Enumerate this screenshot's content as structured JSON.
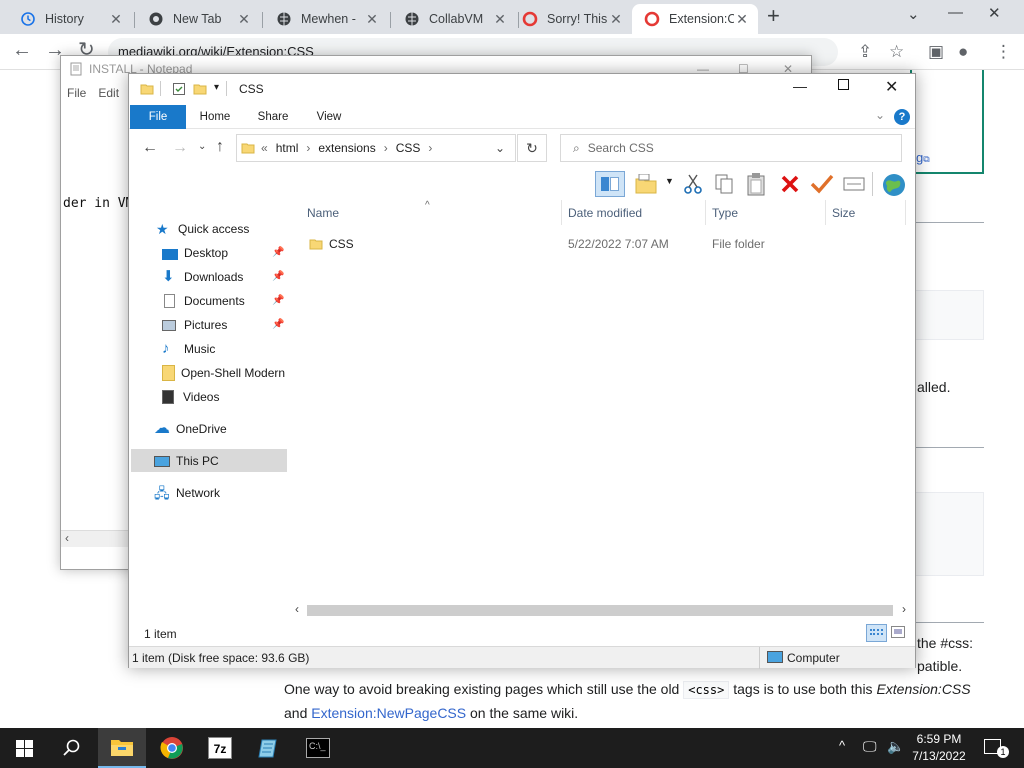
{
  "browser": {
    "tabs": [
      {
        "title": "History",
        "icon": "history-icon"
      },
      {
        "title": "New Tab",
        "icon": "chrome-globe-icon"
      },
      {
        "title": "Mewhen - ",
        "icon": "globe-icon"
      },
      {
        "title": "CollabVM ",
        "icon": "globe-icon"
      },
      {
        "title": "Sorry! This",
        "icon": "opera-icon"
      },
      {
        "title": "Extension:C",
        "icon": "opera-icon",
        "active": true
      }
    ],
    "url": "mediawiki.org/wiki/Extension:CSS"
  },
  "webpage": {
    "frag_link": "g",
    "frag_installed": "alled.",
    "frag_css": "the #css:",
    "frag_compatible": "patible.",
    "line1_pre": "One way to avoid breaking existing pages which still use the old ",
    "line1_code": "<css>",
    "line1_mid": " tags is to use both this ",
    "line1_em": "Extension:CSS",
    "line2_pre": "and ",
    "line2_link": "Extension:NewPageCSS",
    "line2_post": " on the same wiki."
  },
  "notepad": {
    "title": "INSTALL - Notepad",
    "menu": [
      "File",
      "Edit"
    ],
    "text": "der in VM"
  },
  "explorer": {
    "title": "CSS",
    "ribbon_tabs": [
      "File",
      "Home",
      "Share",
      "View"
    ],
    "breadcrumb": [
      "html",
      "extensions",
      "CSS"
    ],
    "search_placeholder": "Search CSS",
    "nav": {
      "quick_access": "Quick access",
      "items": [
        {
          "label": "Desktop",
          "pinned": true
        },
        {
          "label": "Downloads",
          "pinned": true
        },
        {
          "label": "Documents",
          "pinned": true
        },
        {
          "label": "Pictures",
          "pinned": true
        },
        {
          "label": "Music",
          "pinned": false
        },
        {
          "label": "Open-Shell Modern",
          "pinned": false
        },
        {
          "label": "Videos",
          "pinned": false
        }
      ],
      "onedrive": "OneDrive",
      "this_pc": "This PC",
      "network": "Network"
    },
    "columns": [
      "Name",
      "Date modified",
      "Type",
      "Size"
    ],
    "rows": [
      {
        "name": "CSS",
        "date": "5/22/2022 7:07 AM",
        "type": "File folder",
        "size": ""
      }
    ],
    "item_count": "1 item",
    "status_free": "1 item (Disk free space: 93.6 GB)",
    "status_location": "Computer"
  },
  "taskbar": {
    "time": "6:59 PM",
    "date": "7/13/2022",
    "notif_count": "1"
  },
  "colors": {
    "accent": "#1979ca",
    "taskbar": "#1d1d1d"
  }
}
